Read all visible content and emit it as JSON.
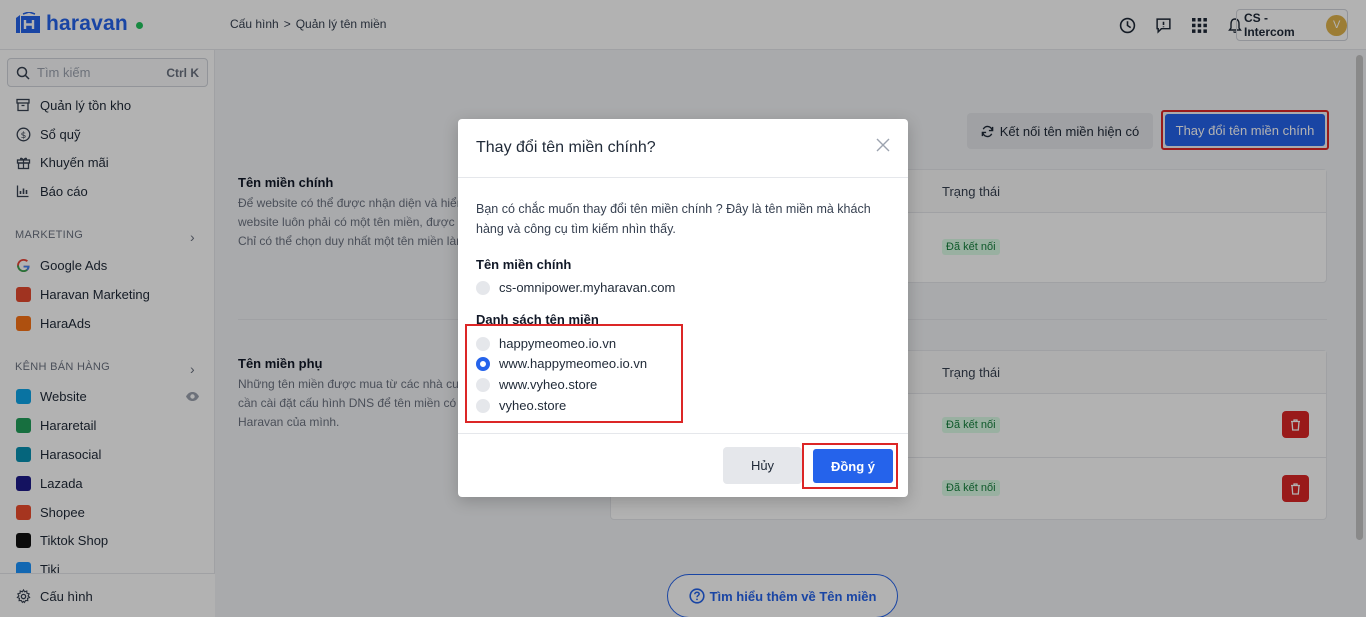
{
  "brand": {
    "name": "haravan"
  },
  "breadcrumb": {
    "parent": "Cấu hình",
    "separator": ">",
    "current": "Quản lý tên miền"
  },
  "account": {
    "name": "CS - Intercom",
    "initial": "V"
  },
  "search": {
    "placeholder": "Tìm kiếm",
    "shortcut": "Ctrl K"
  },
  "sidebar": {
    "items": [
      {
        "label": "Quản lý tồn kho",
        "icon": "inventory-icon"
      },
      {
        "label": "Sổ quỹ",
        "icon": "cashbook-icon"
      },
      {
        "label": "Khuyến mãi",
        "icon": "promotion-icon"
      },
      {
        "label": "Báo cáo",
        "icon": "report-icon"
      }
    ],
    "marketing_section": "MARKETING",
    "marketing": [
      {
        "label": "Google Ads",
        "icon": "google-icon"
      },
      {
        "label": "Haravan Marketing",
        "icon": "haravan-marketing-icon"
      },
      {
        "label": "HaraAds",
        "icon": "haraads-icon"
      }
    ],
    "channels_section": "KÊNH BÁN HÀNG",
    "channels": [
      {
        "label": "Website",
        "icon": "website-icon"
      },
      {
        "label": "Hararetail",
        "icon": "hararetail-icon"
      },
      {
        "label": "Harasocial",
        "icon": "harasocial-icon"
      },
      {
        "label": "Lazada",
        "icon": "lazada-icon"
      },
      {
        "label": "Shopee",
        "icon": "shopee-icon"
      },
      {
        "label": "Tiktok Shop",
        "icon": "tiktok-icon"
      },
      {
        "label": "Tiki",
        "icon": "tiki-icon"
      }
    ],
    "settings": "Cấu hình"
  },
  "main": {
    "connect_button": "Kết nối tên miền hiện có",
    "change_button": "Thay đổi tên miền chính",
    "primary": {
      "title": "Tên miền chính",
      "desc_lines": [
        "Để website có thể được nhận diện và hiển thị",
        "website luôn phải có một tên miền, được",
        "Chỉ có thể chọn duy nhất một tên miền làm"
      ],
      "status_header": "Trạng thái",
      "status": "Đã kết nối"
    },
    "secondary": {
      "title": "Tên miền phụ",
      "desc_lines": [
        "Những tên miền được mua từ các nhà cung cấp",
        "cần cài đặt cấu hình DNS để tên miền có",
        "Haravan của mình."
      ],
      "status_header": "Trạng thái",
      "status1": "Đã kết nối",
      "status2": "Đã kết nối"
    },
    "learn_more": "Tìm hiểu thêm về Tên miền"
  },
  "modal": {
    "title": "Thay đổi tên miền chính?",
    "text": "Bạn có chắc muốn thay đổi tên miền chính ? Đây là tên miền mà khách hàng và công cụ tìm kiếm nhìn thấy.",
    "primary_label": "Tên miền chính",
    "primary_domain": "cs-omnipower.myharavan.com",
    "list_label": "Danh sách tên miền",
    "domains": [
      "happymeomeo.io.vn",
      "www.happymeomeo.io.vn",
      "www.vyheo.store",
      "vyheo.store"
    ],
    "selected_index": 1,
    "cancel": "Hủy",
    "confirm": "Đồng ý"
  },
  "colors": {
    "accent": "#2563eb",
    "danger": "#dc2626",
    "success": "#15803d"
  }
}
